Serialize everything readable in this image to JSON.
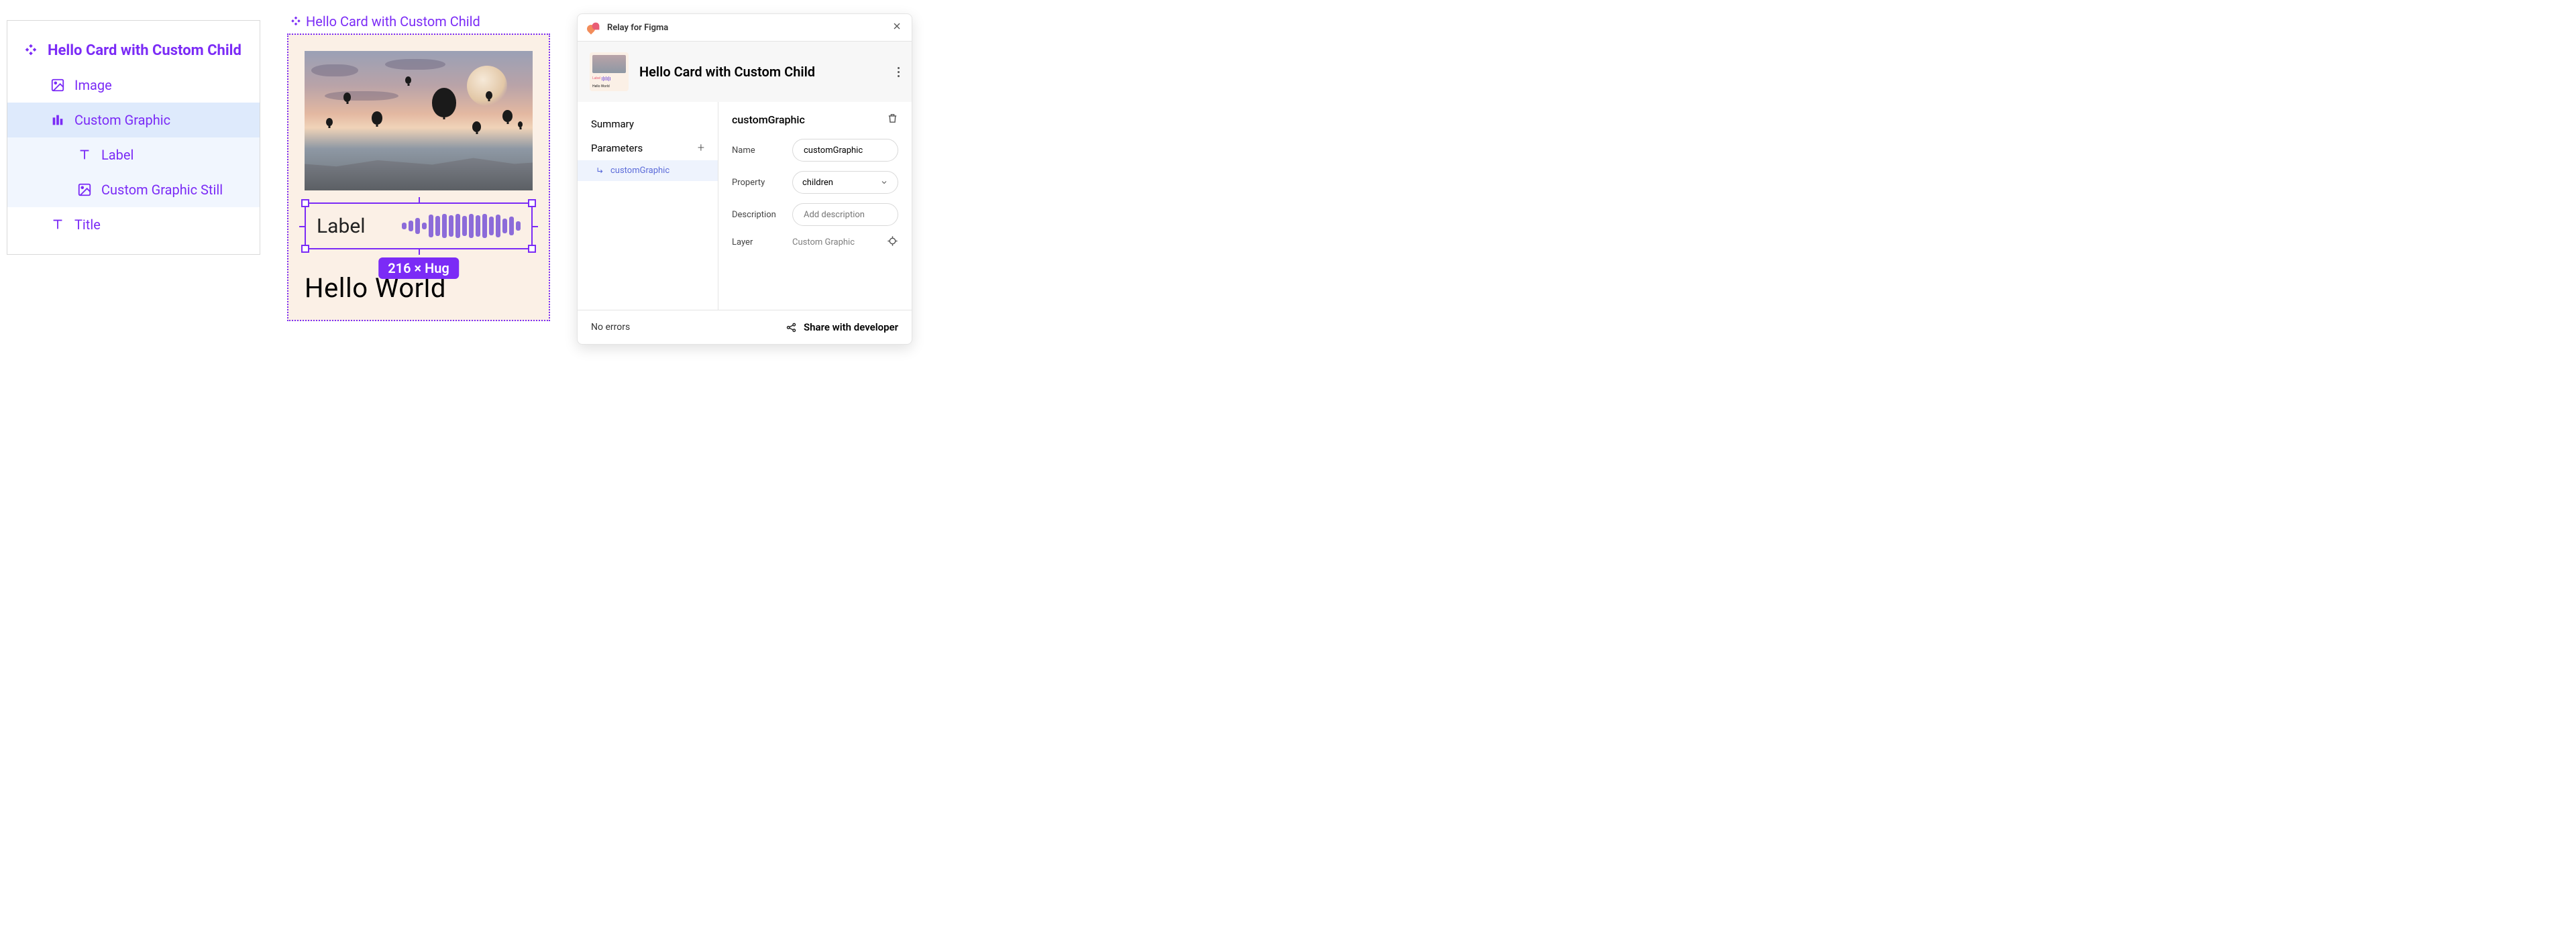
{
  "layers": {
    "root": "Hello Card with Custom Child",
    "image": "Image",
    "custom_graphic": "Custom Graphic",
    "label": "Label",
    "still": "Custom Graphic Still",
    "title": "Title"
  },
  "canvas": {
    "header": "Hello Card with Custom Child",
    "label": "Label",
    "title": "Hello World",
    "dimensions": "216 × Hug"
  },
  "plugin": {
    "brand": "Relay for Figma",
    "title": "Hello Card with Custom Child",
    "side": {
      "summary": "Summary",
      "parameters": "Parameters",
      "param1": "customGraphic"
    },
    "details": {
      "heading": "customGraphic",
      "name_label": "Name",
      "name_value": "customGraphic",
      "property_label": "Property",
      "property_value": "children",
      "description_label": "Description",
      "description_placeholder": "Add description",
      "layer_label": "Layer",
      "layer_value": "Custom Graphic"
    },
    "footer": {
      "status": "No errors",
      "share": "Share with developer"
    }
  },
  "thumb_label": "Label",
  "thumb_title": "Hello World"
}
